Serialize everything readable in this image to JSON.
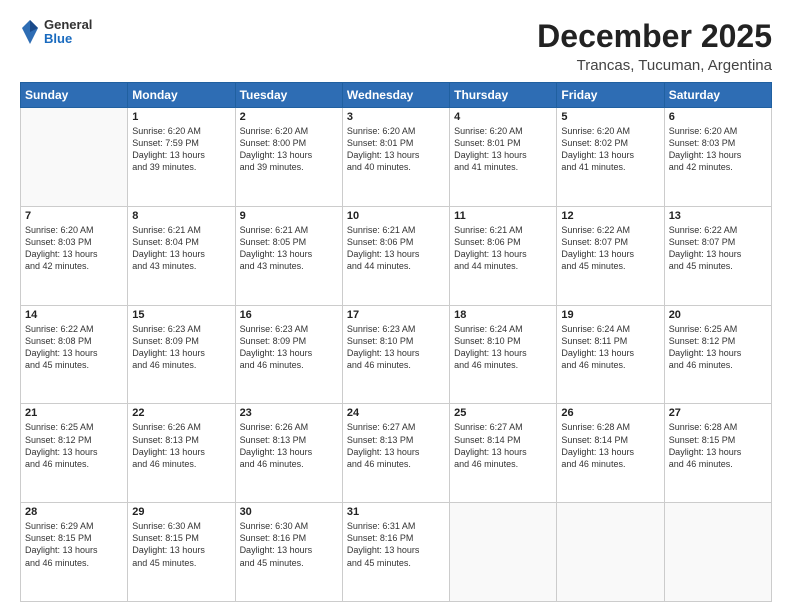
{
  "logo": {
    "general": "General",
    "blue": "Blue"
  },
  "title": "December 2025",
  "subtitle": "Trancas, Tucuman, Argentina",
  "headers": [
    "Sunday",
    "Monday",
    "Tuesday",
    "Wednesday",
    "Thursday",
    "Friday",
    "Saturday"
  ],
  "weeks": [
    [
      {
        "day": "",
        "info": ""
      },
      {
        "day": "1",
        "info": "Sunrise: 6:20 AM\nSunset: 7:59 PM\nDaylight: 13 hours\nand 39 minutes."
      },
      {
        "day": "2",
        "info": "Sunrise: 6:20 AM\nSunset: 8:00 PM\nDaylight: 13 hours\nand 39 minutes."
      },
      {
        "day": "3",
        "info": "Sunrise: 6:20 AM\nSunset: 8:01 PM\nDaylight: 13 hours\nand 40 minutes."
      },
      {
        "day": "4",
        "info": "Sunrise: 6:20 AM\nSunset: 8:01 PM\nDaylight: 13 hours\nand 41 minutes."
      },
      {
        "day": "5",
        "info": "Sunrise: 6:20 AM\nSunset: 8:02 PM\nDaylight: 13 hours\nand 41 minutes."
      },
      {
        "day": "6",
        "info": "Sunrise: 6:20 AM\nSunset: 8:03 PM\nDaylight: 13 hours\nand 42 minutes."
      }
    ],
    [
      {
        "day": "7",
        "info": "Sunrise: 6:20 AM\nSunset: 8:03 PM\nDaylight: 13 hours\nand 42 minutes."
      },
      {
        "day": "8",
        "info": "Sunrise: 6:21 AM\nSunset: 8:04 PM\nDaylight: 13 hours\nand 43 minutes."
      },
      {
        "day": "9",
        "info": "Sunrise: 6:21 AM\nSunset: 8:05 PM\nDaylight: 13 hours\nand 43 minutes."
      },
      {
        "day": "10",
        "info": "Sunrise: 6:21 AM\nSunset: 8:06 PM\nDaylight: 13 hours\nand 44 minutes."
      },
      {
        "day": "11",
        "info": "Sunrise: 6:21 AM\nSunset: 8:06 PM\nDaylight: 13 hours\nand 44 minutes."
      },
      {
        "day": "12",
        "info": "Sunrise: 6:22 AM\nSunset: 8:07 PM\nDaylight: 13 hours\nand 45 minutes."
      },
      {
        "day": "13",
        "info": "Sunrise: 6:22 AM\nSunset: 8:07 PM\nDaylight: 13 hours\nand 45 minutes."
      }
    ],
    [
      {
        "day": "14",
        "info": "Sunrise: 6:22 AM\nSunset: 8:08 PM\nDaylight: 13 hours\nand 45 minutes."
      },
      {
        "day": "15",
        "info": "Sunrise: 6:23 AM\nSunset: 8:09 PM\nDaylight: 13 hours\nand 46 minutes."
      },
      {
        "day": "16",
        "info": "Sunrise: 6:23 AM\nSunset: 8:09 PM\nDaylight: 13 hours\nand 46 minutes."
      },
      {
        "day": "17",
        "info": "Sunrise: 6:23 AM\nSunset: 8:10 PM\nDaylight: 13 hours\nand 46 minutes."
      },
      {
        "day": "18",
        "info": "Sunrise: 6:24 AM\nSunset: 8:10 PM\nDaylight: 13 hours\nand 46 minutes."
      },
      {
        "day": "19",
        "info": "Sunrise: 6:24 AM\nSunset: 8:11 PM\nDaylight: 13 hours\nand 46 minutes."
      },
      {
        "day": "20",
        "info": "Sunrise: 6:25 AM\nSunset: 8:12 PM\nDaylight: 13 hours\nand 46 minutes."
      }
    ],
    [
      {
        "day": "21",
        "info": "Sunrise: 6:25 AM\nSunset: 8:12 PM\nDaylight: 13 hours\nand 46 minutes."
      },
      {
        "day": "22",
        "info": "Sunrise: 6:26 AM\nSunset: 8:13 PM\nDaylight: 13 hours\nand 46 minutes."
      },
      {
        "day": "23",
        "info": "Sunrise: 6:26 AM\nSunset: 8:13 PM\nDaylight: 13 hours\nand 46 minutes."
      },
      {
        "day": "24",
        "info": "Sunrise: 6:27 AM\nSunset: 8:13 PM\nDaylight: 13 hours\nand 46 minutes."
      },
      {
        "day": "25",
        "info": "Sunrise: 6:27 AM\nSunset: 8:14 PM\nDaylight: 13 hours\nand 46 minutes."
      },
      {
        "day": "26",
        "info": "Sunrise: 6:28 AM\nSunset: 8:14 PM\nDaylight: 13 hours\nand 46 minutes."
      },
      {
        "day": "27",
        "info": "Sunrise: 6:28 AM\nSunset: 8:15 PM\nDaylight: 13 hours\nand 46 minutes."
      }
    ],
    [
      {
        "day": "28",
        "info": "Sunrise: 6:29 AM\nSunset: 8:15 PM\nDaylight: 13 hours\nand 46 minutes."
      },
      {
        "day": "29",
        "info": "Sunrise: 6:30 AM\nSunset: 8:15 PM\nDaylight: 13 hours\nand 45 minutes."
      },
      {
        "day": "30",
        "info": "Sunrise: 6:30 AM\nSunset: 8:16 PM\nDaylight: 13 hours\nand 45 minutes."
      },
      {
        "day": "31",
        "info": "Sunrise: 6:31 AM\nSunset: 8:16 PM\nDaylight: 13 hours\nand 45 minutes."
      },
      {
        "day": "",
        "info": ""
      },
      {
        "day": "",
        "info": ""
      },
      {
        "day": "",
        "info": ""
      }
    ]
  ]
}
